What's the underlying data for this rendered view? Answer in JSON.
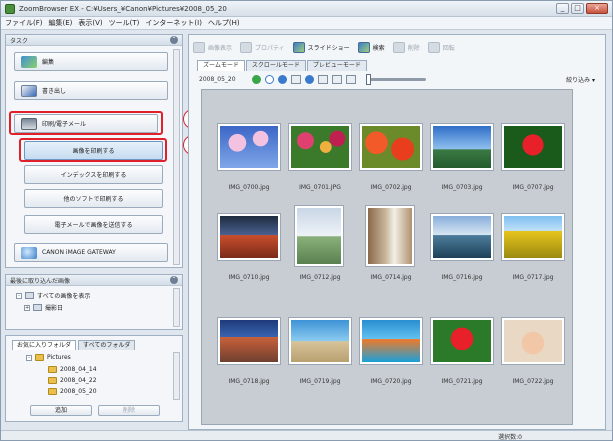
{
  "window": {
    "title": "ZoomBrowser EX - C:¥Users_¥Canon¥Pictures¥2008_05_20",
    "min_label": "_",
    "max_label": "□",
    "close_label": "×"
  },
  "menu": [
    "ファイル(F)",
    "編集(E)",
    "表示(V)",
    "ツール(T)",
    "インターネット(I)",
    "ヘルプ(H)"
  ],
  "tasks": {
    "header": "タスク",
    "collapse_label": "⌃",
    "edit": "編集",
    "export": "書き出し",
    "print_email": "印刷/電子メール",
    "print_image": "画像を印刷する",
    "print_index": "インデックスを印刷する",
    "print_layout": "他のソフトで印刷する",
    "email_images": "電子メールで画像を送信する",
    "gateway": "CANON iMAGE GATEWAY"
  },
  "import_pane": {
    "header": "最後に取り込んだ画像",
    "row1": "すべての画像を表示",
    "row2": "撮影日"
  },
  "folder_pane": {
    "tab_favorites": "お気に入りフォルダ",
    "tab_all": "すべてのフォルダ",
    "root": "Pictures",
    "folders": [
      "2008_04_14",
      "2008_04_22",
      "2008_05_20"
    ],
    "add_button": "追加",
    "remove_button": "削除"
  },
  "toolbar": {
    "items": [
      "画像表示",
      "プロパティ",
      "スライドショー",
      "検索",
      "削除",
      "回転"
    ]
  },
  "modes": [
    "ズームモード",
    "スクロールモード",
    "プレビューモード"
  ],
  "subbar": {
    "date": "2008_05_20",
    "sort_label": "絞り込み ▾"
  },
  "images": [
    "IMG_0700.jpg",
    "IMG_0701.JPG",
    "IMG_0702.jpg",
    "IMG_0703.jpg",
    "IMG_0707.jpg",
    "IMG_0710.jpg",
    "IMG_0712.jpg",
    "IMG_0714.jpg",
    "IMG_0716.jpg",
    "IMG_0717.jpg",
    "IMG_0718.jpg",
    "IMG_0719.jpg",
    "IMG_0720.jpg",
    "IMG_0721.jpg",
    "IMG_0722.jpg"
  ],
  "callouts": {
    "one": "①",
    "two": "②"
  },
  "status": {
    "selected": "選択数:0"
  },
  "colors": {
    "highlight_red": "#e0202a",
    "accent_blue": "#3a7acc"
  }
}
